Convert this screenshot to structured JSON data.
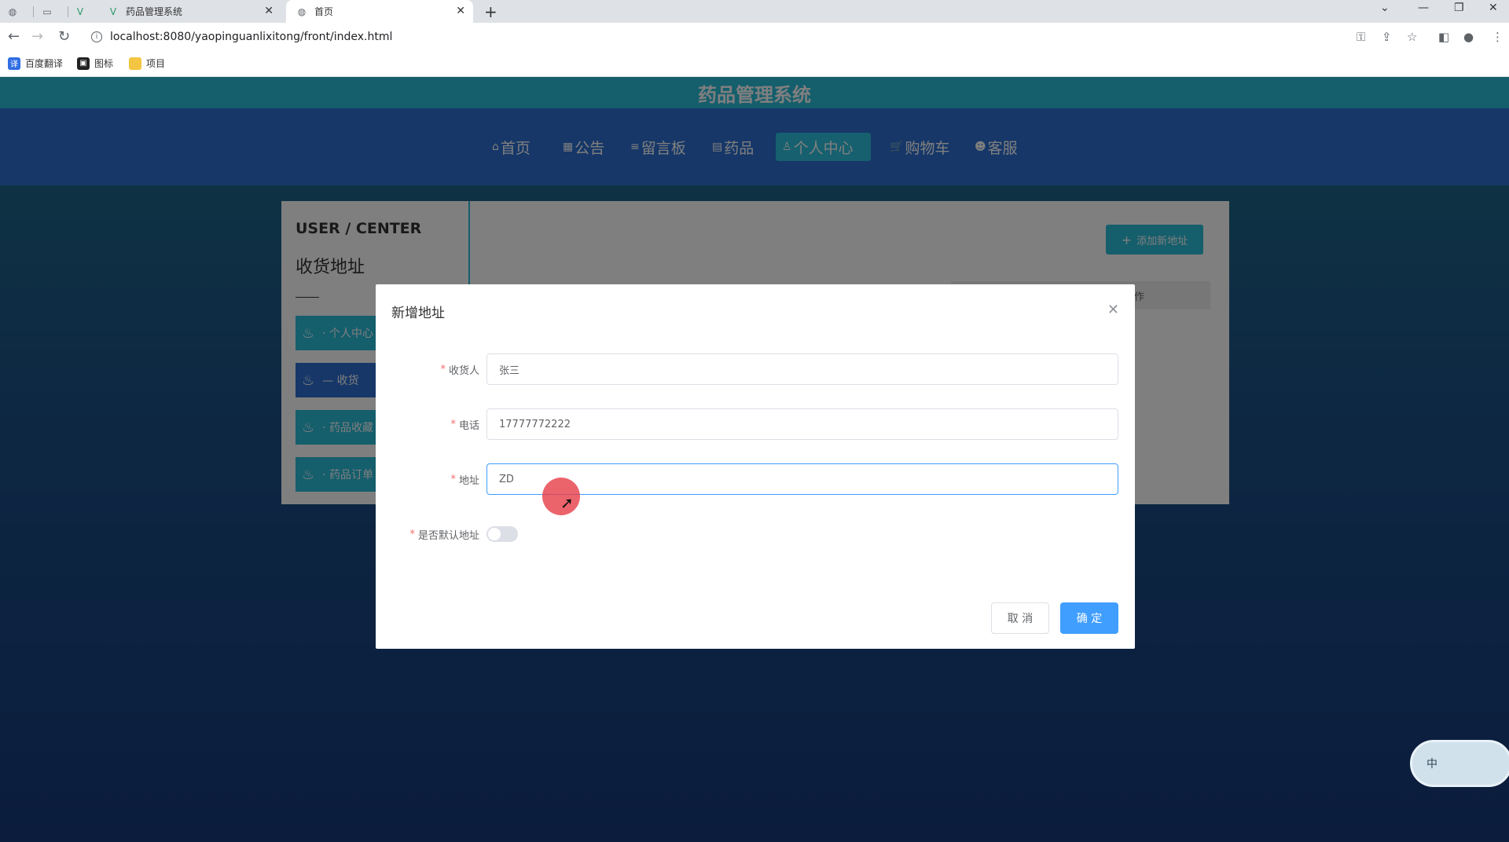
{
  "browser": {
    "tabs": [
      {
        "title": ""
      },
      {
        "title": ""
      },
      {
        "title": ""
      },
      {
        "title": "药品管理系统"
      },
      {
        "title": "首页"
      }
    ],
    "new_tab": "+",
    "url": "localhost:8080/yaopinguanlixitong/front/index.html",
    "bookmarks": [
      "百度翻译",
      "图标",
      "项目"
    ]
  },
  "site": {
    "title": "药品管理系统",
    "nav": [
      {
        "label": "首页",
        "icon": "⌂"
      },
      {
        "label": "公告",
        "icon": "▦"
      },
      {
        "label": "留言板",
        "icon": "≡"
      },
      {
        "label": "药品",
        "icon": "▤"
      },
      {
        "label": "个人中心",
        "icon": "♙"
      },
      {
        "label": "购物车",
        "icon": "🛒"
      },
      {
        "label": "客服",
        "icon": "☻"
      }
    ]
  },
  "user_center": {
    "title": "USER / CENTER",
    "subtitle": "收货地址",
    "menu": [
      "· 个人中心",
      "— 收货",
      "· 药品收藏",
      "· 药品订单"
    ],
    "add_button": "添加新地址",
    "table_header_action": "作"
  },
  "modal": {
    "title": "新增地址",
    "fields": {
      "receiver": {
        "label": "收货人",
        "value": "张三"
      },
      "phone": {
        "label": "电话",
        "value": "17777772222"
      },
      "address": {
        "label": "地址",
        "value": "ZD"
      },
      "default": {
        "label": "是否默认地址",
        "value": false
      }
    },
    "cancel": "取 消",
    "confirm": "确 定"
  },
  "ime": {
    "label": "中"
  }
}
